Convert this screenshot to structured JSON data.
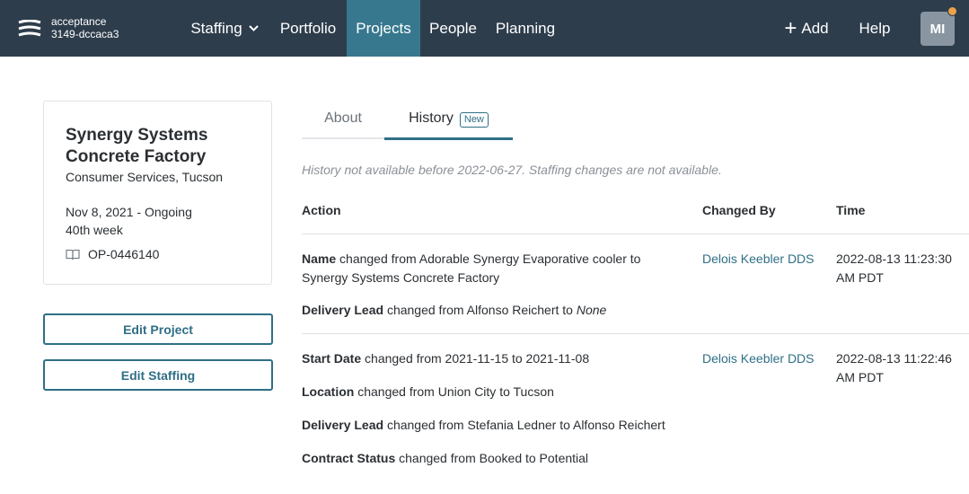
{
  "header": {
    "env_name": "acceptance",
    "env_id": "3149-dccaca3",
    "nav": [
      {
        "label": "Staffing"
      },
      {
        "label": "Portfolio"
      },
      {
        "label": "Projects"
      },
      {
        "label": "People"
      },
      {
        "label": "Planning"
      }
    ],
    "add_label": "Add",
    "help_label": "Help",
    "avatar_initials": "MI"
  },
  "project": {
    "title": "Synergy Systems Concrete Factory",
    "subtitle": "Consumer Services, Tucson",
    "date_range": "Nov 8, 2021 - Ongoing",
    "week": "40th week",
    "code": "OP-0446140"
  },
  "buttons": {
    "edit_project": "Edit Project",
    "edit_staffing": "Edit Staffing"
  },
  "tabs": {
    "about": "About",
    "history": "History",
    "new_badge": "New"
  },
  "history_note": "History not available before 2022-06-27. Staffing changes are not available.",
  "table": {
    "headers": {
      "action": "Action",
      "changed_by": "Changed By",
      "time": "Time"
    },
    "rows": [
      {
        "changes": [
          {
            "field": "Name",
            "text": " changed from Adorable Synergy Evaporative cooler to Synergy Systems Concrete Factory"
          },
          {
            "field": "Delivery Lead",
            "text": " changed from Alfonso Reichert to ",
            "emphasis": "None"
          }
        ],
        "changed_by": "Delois Keebler DDS",
        "time": "2022-08-13 11:23:30 AM PDT"
      },
      {
        "changes": [
          {
            "field": "Start Date",
            "text": " changed from 2021-11-15 to 2021-11-08"
          },
          {
            "field": "Location",
            "text": " changed from Union City to Tucson"
          },
          {
            "field": "Delivery Lead",
            "text": " changed from Stefania Ledner to Alfonso Reichert"
          },
          {
            "field": "Contract Status",
            "text": " changed from Booked to Potential"
          }
        ],
        "changed_by": "Delois Keebler DDS",
        "time": "2022-08-13 11:22:46 AM PDT"
      }
    ]
  }
}
